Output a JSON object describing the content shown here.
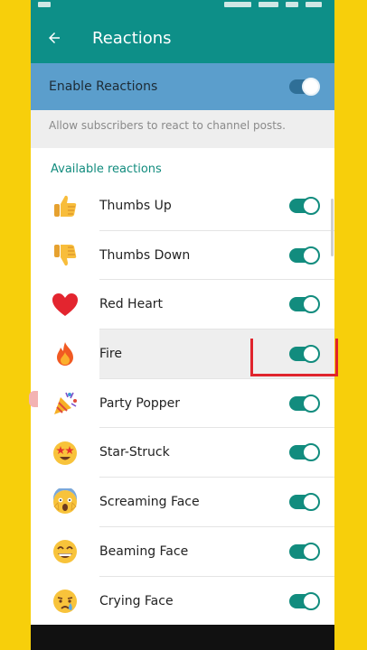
{
  "appbar": {
    "title": "Reactions",
    "back_icon": "arrow-left-icon"
  },
  "enable": {
    "label": "Enable Reactions",
    "on": true
  },
  "hint": "Allow subscribers to react to channel posts.",
  "section_title": "Available reactions",
  "reactions": [
    {
      "label": "Thumbs Up",
      "icon": "thumbs-up-icon",
      "on": true
    },
    {
      "label": "Thumbs Down",
      "icon": "thumbs-down-icon",
      "on": true
    },
    {
      "label": "Red Heart",
      "icon": "red-heart-icon",
      "on": true
    },
    {
      "label": "Fire",
      "icon": "fire-icon",
      "on": true
    },
    {
      "label": "Party Popper",
      "icon": "party-popper-icon",
      "on": true
    },
    {
      "label": "Star-Struck",
      "icon": "star-struck-icon",
      "on": true
    },
    {
      "label": "Screaming Face",
      "icon": "screaming-face-icon",
      "on": true
    },
    {
      "label": "Beaming Face",
      "icon": "beaming-face-icon",
      "on": true
    },
    {
      "label": "Crying Face",
      "icon": "crying-face-icon",
      "on": true
    }
  ],
  "colors": {
    "appbar": "#0d8f88",
    "accent": "#128c7e",
    "enable_row": "#5b9ecc",
    "frame": "#f7cf0b",
    "highlight": "#e0242c"
  }
}
